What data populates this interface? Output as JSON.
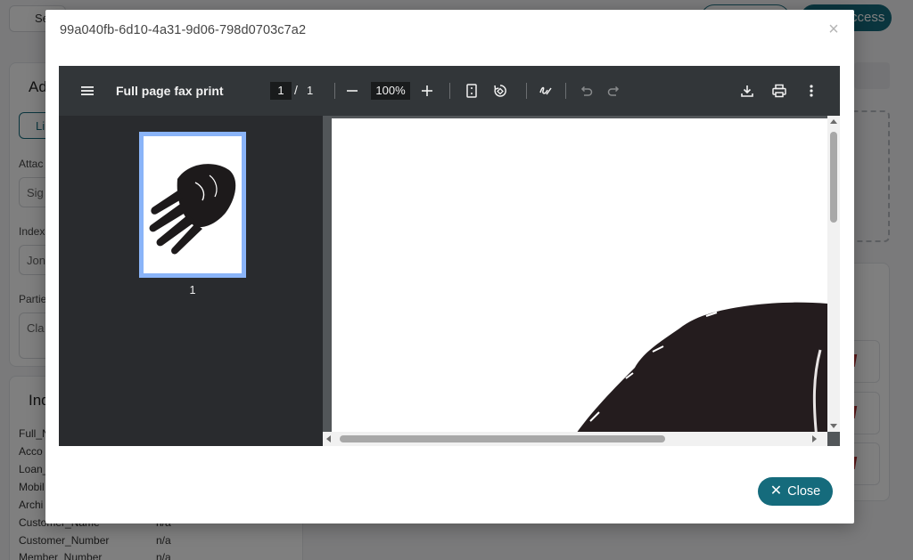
{
  "background": {
    "top_button": "Se",
    "pill_solid_label": "ccess",
    "card1_title": "Ad",
    "tab_button": "Li",
    "fields": [
      {
        "label": "Attac",
        "value": "Sig"
      },
      {
        "label": "Index",
        "value": "Jon"
      },
      {
        "label": "Partie",
        "value": "Cla"
      }
    ],
    "card2_title": "Ind",
    "info_rows": [
      {
        "key": "Full_N",
        "value": ""
      },
      {
        "key": "Acco",
        "value": ""
      },
      {
        "key": "Loan_",
        "value": ""
      },
      {
        "key": "Mobil",
        "value": ""
      },
      {
        "key": "Archi",
        "value": ""
      },
      {
        "key": "Customer_Name",
        "value": "n/a"
      },
      {
        "key": "Customer_Number",
        "value": "n/a"
      },
      {
        "key": "Member_Number",
        "value": "n/a"
      }
    ]
  },
  "modal": {
    "title": "99a040fb-6d10-4a31-9d06-798d0703c7a2",
    "close_x": "×",
    "close_button_label": "Close",
    "close_button_icon": "✕"
  },
  "viewer": {
    "document_title": "Full page fax print",
    "current_page": "1",
    "page_separator": "/",
    "total_pages": "1",
    "zoom": "100%",
    "thumbnail_label": "1"
  },
  "colors": {
    "accent": "#156b7c",
    "toolbar": "#323639",
    "sidebar": "#292b2e",
    "thumb_border": "#8ab4f8"
  }
}
